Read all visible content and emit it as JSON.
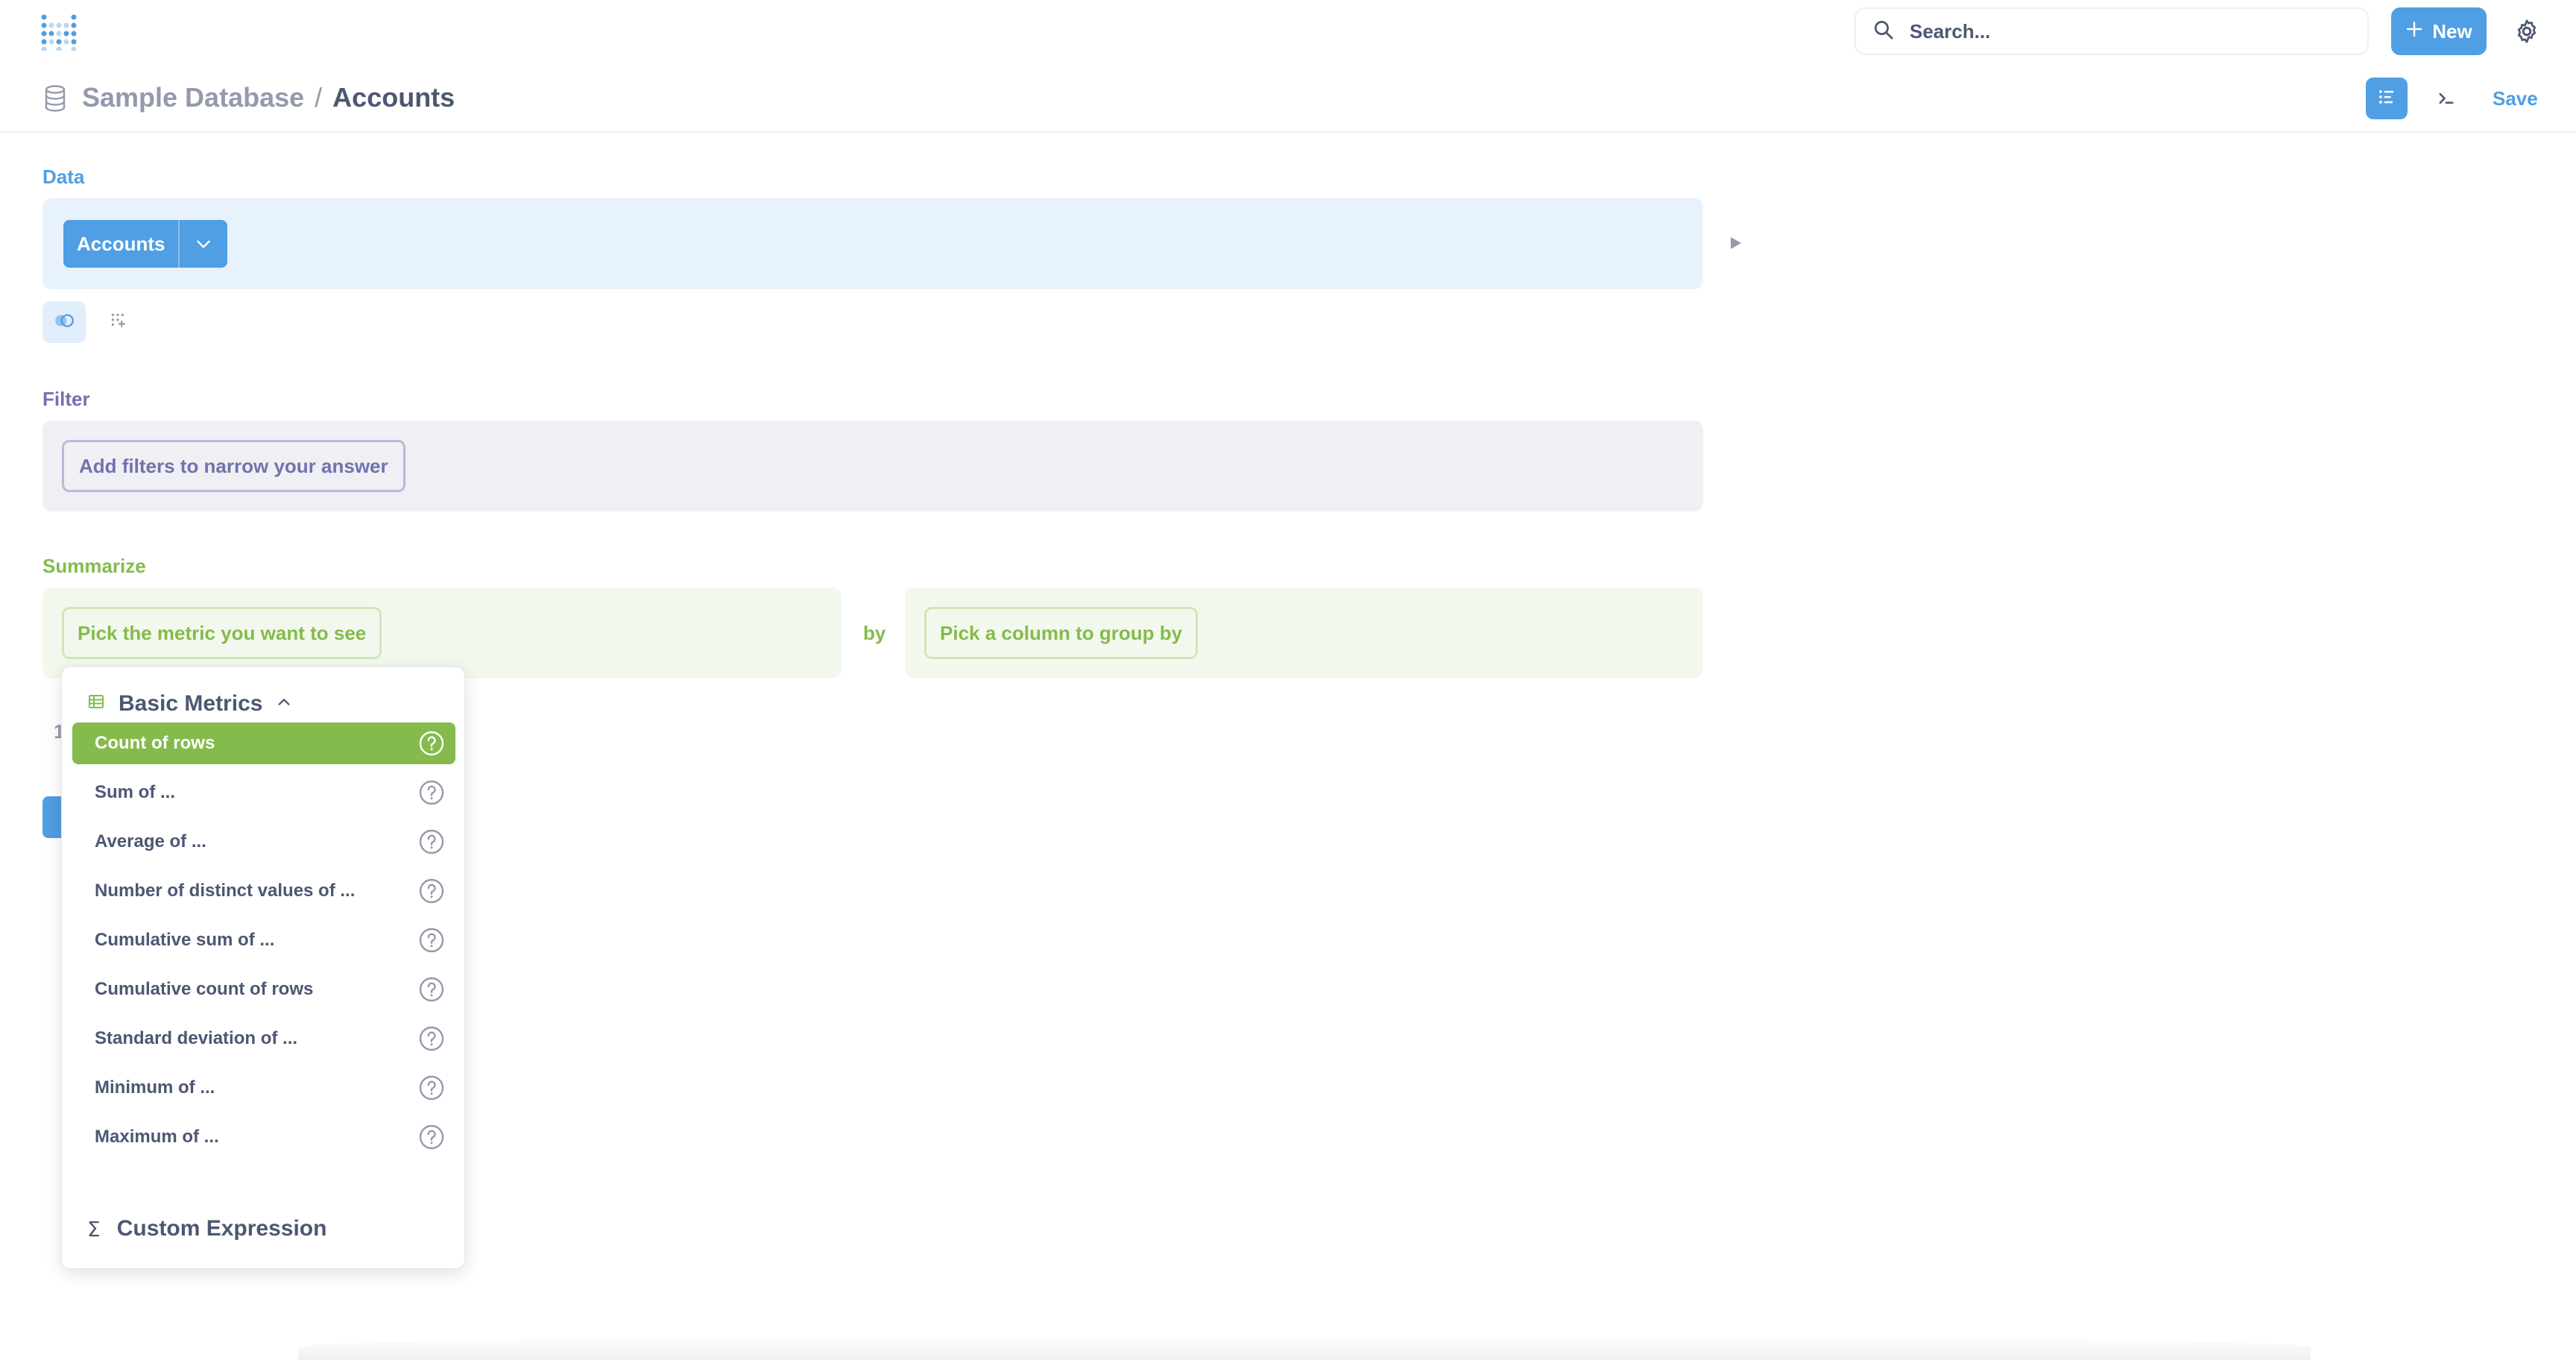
{
  "nav": {
    "search_placeholder": "Search...",
    "new_label": "New"
  },
  "header": {
    "database": "Sample Database",
    "separator": "/",
    "table": "Accounts",
    "save_label": "Save"
  },
  "notebook": {
    "data_label": "Data",
    "table_name": "Accounts",
    "filter_label": "Filter",
    "filter_placeholder": "Add filters to narrow your answer",
    "summarize_label": "Summarize",
    "metric_placeholder": "Pick the metric you want to see",
    "by_label": "by",
    "groupby_placeholder": "Pick a column to group by",
    "hidden_step_text": "1"
  },
  "popover": {
    "section_title": "Basic Metrics",
    "items": [
      {
        "label": "Count of rows",
        "active": true
      },
      {
        "label": "Sum of ..."
      },
      {
        "label": "Average of ..."
      },
      {
        "label": "Number of distinct values of ..."
      },
      {
        "label": "Cumulative sum of ..."
      },
      {
        "label": "Cumulative count of rows"
      },
      {
        "label": "Standard deviation of ..."
      },
      {
        "label": "Minimum of ..."
      },
      {
        "label": "Maximum of ..."
      }
    ],
    "footer_symbol": "Σ",
    "footer_title": "Custom Expression"
  },
  "colors": {
    "brand": "#509ee3",
    "summarize": "#84bb4c",
    "filter": "#7172ad",
    "text": "#4c5773"
  }
}
